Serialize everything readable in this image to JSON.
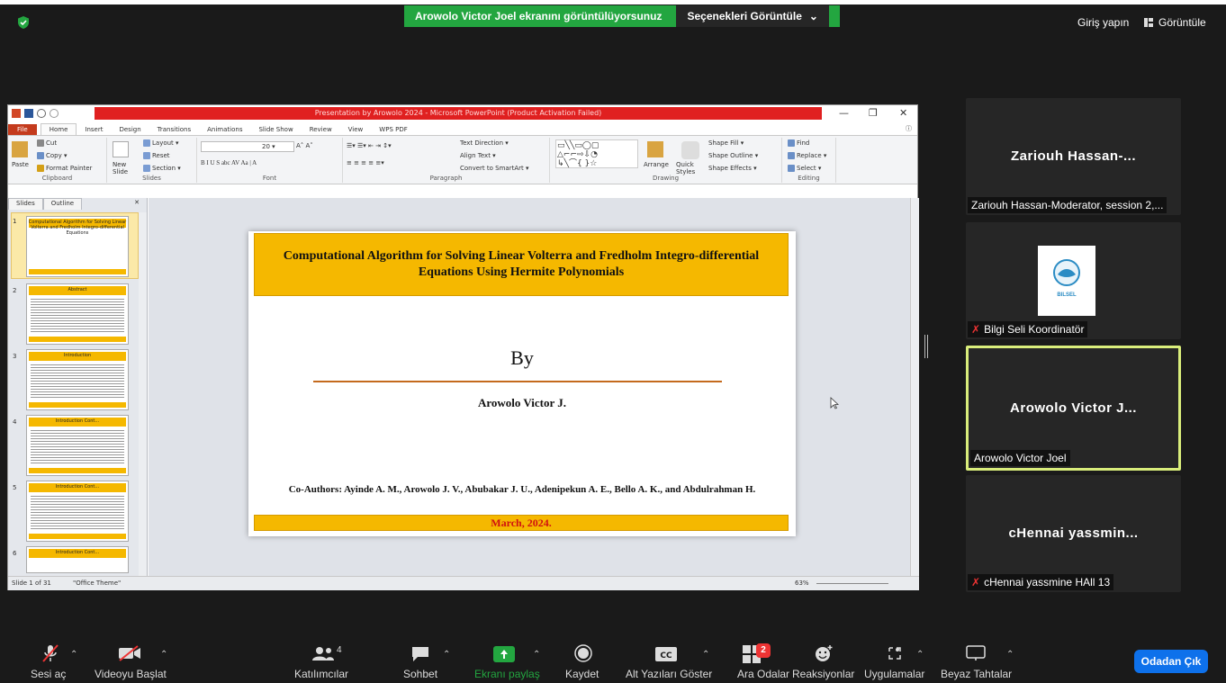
{
  "zoom_top": {
    "share_banner": "Arowolo Victor Joel ekranını görüntülüyorsunuz",
    "options_label": "Seçenekleri Görüntüle",
    "signin_label": "Giriş yapın",
    "view_label": "Görüntüle"
  },
  "ppt": {
    "title": "Presentation by Arowolo 2024 - Microsoft PowerPoint (Product Activation Failed)",
    "tabs": [
      "File",
      "Home",
      "Insert",
      "Design",
      "Transitions",
      "Animations",
      "Slide Show",
      "Review",
      "View",
      "WPS PDF"
    ],
    "ribbon": {
      "paste": "Paste",
      "cut": "Cut",
      "copy": "Copy",
      "format_painter": "Format Painter",
      "clipboard": "Clipboard",
      "new_slide": "New Slide",
      "layout": "Layout",
      "reset": "Reset",
      "section": "Section",
      "slides": "Slides",
      "font_size": "20",
      "font": "Font",
      "paragraph": "Paragraph",
      "text_direction": "Text Direction",
      "align_text": "Align Text",
      "convert_smartart": "Convert to SmartArt",
      "arrange": "Arrange",
      "quick_styles": "Quick Styles",
      "shape_fill": "Shape Fill",
      "shape_outline": "Shape Outline",
      "shape_effects": "Shape Effects",
      "drawing": "Drawing",
      "find": "Find",
      "replace": "Replace",
      "select": "Select",
      "editing": "Editing"
    },
    "panel_tabs": [
      "Slides",
      "Outline"
    ],
    "thumbs": [
      {
        "num": "1",
        "title": "Computational Algorithm for Solving Linear Volterra and Fredholm Integro-differential Equations"
      },
      {
        "num": "2",
        "title": "Abstract"
      },
      {
        "num": "3",
        "title": "Introduction"
      },
      {
        "num": "4",
        "title": "Introduction Cont..."
      },
      {
        "num": "5",
        "title": "Introduction Cont..."
      },
      {
        "num": "6",
        "title": "Introduction Cont..."
      }
    ],
    "status": {
      "slide_of": "Slide 1 of 31",
      "theme": "\"Office Theme\"",
      "zoom": "63%"
    }
  },
  "slide": {
    "title": "Computational Algorithm for Solving Linear Volterra and Fredholm Integro-differential Equations Using Hermite Polynomials",
    "by": "By",
    "author": "Arowolo Victor J.",
    "coauthors": "Co-Authors: Ayinde A. M., Arowolo J. V., Abubakar J. U., Adenipekun A. E., Bello A. K., and Abdulrahman H.",
    "date": "March, 2024."
  },
  "participants": [
    {
      "display": "Zariouh Hassan-...",
      "label": "Zariouh Hassan-Moderator, session 2,...",
      "muted": false
    },
    {
      "display": "",
      "label": "Bilgi Seli Koordinatör",
      "muted": true,
      "logo_text": "BILSEL"
    },
    {
      "display": "Arowolo Victor J...",
      "label": "Arowolo Victor Joel",
      "muted": false,
      "active": true
    },
    {
      "display": "cHennai yassmin...",
      "label": "cHennai yassmine HAll 13",
      "muted": true
    }
  ],
  "toolbar": {
    "mute": "Sesi aç",
    "video": "Videoyu Başlat",
    "participants": "Katılımcılar",
    "participants_count": "4",
    "chat": "Sohbet",
    "share": "Ekranı paylaş",
    "record": "Kaydet",
    "captions": "Alt Yazıları Göster",
    "breakout": "Ara Odalar",
    "breakout_badge": "2",
    "reactions": "Reaksiyonlar",
    "apps": "Uygulamalar",
    "whiteboard": "Beyaz Tahtalar",
    "leave": "Odadan Çık"
  },
  "colors": {
    "share_green": "#23a640",
    "slide_gold": "#f5b800",
    "leave_blue": "#0e71eb",
    "active_border": "#d9ed7b"
  }
}
